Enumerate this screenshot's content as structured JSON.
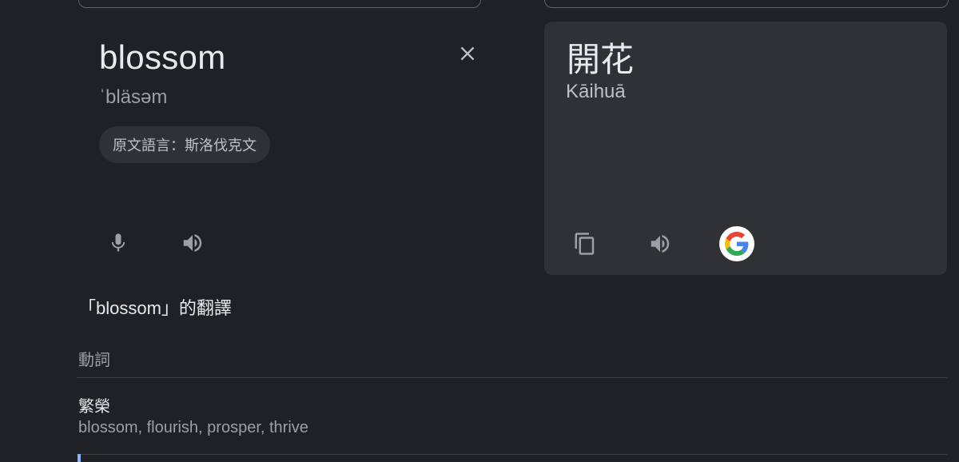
{
  "source": {
    "word": "blossom",
    "phonetic": "ˈbläsəm",
    "detected_language_label": "原文語言：斯洛伐克文",
    "icons": {
      "close": "close-icon",
      "mic": "mic-icon",
      "speaker": "speaker-icon"
    }
  },
  "target": {
    "translation": "開花",
    "romanization": "Kāihuā",
    "icons": {
      "copy": "copy-icon",
      "speaker": "speaker-icon",
      "google": "google-logo-icon"
    }
  },
  "dictionary": {
    "heading": "「blossom」的翻譯",
    "part_of_speech": "動詞",
    "entries": [
      {
        "term": "繁榮",
        "synonyms": "blossom, flourish, prosper, thrive"
      }
    ]
  },
  "colors": {
    "background": "#202124",
    "panel": "#303134",
    "text_primary": "#e8eaed",
    "text_secondary": "#9aa0a6",
    "accent": "#8ab4f8"
  }
}
